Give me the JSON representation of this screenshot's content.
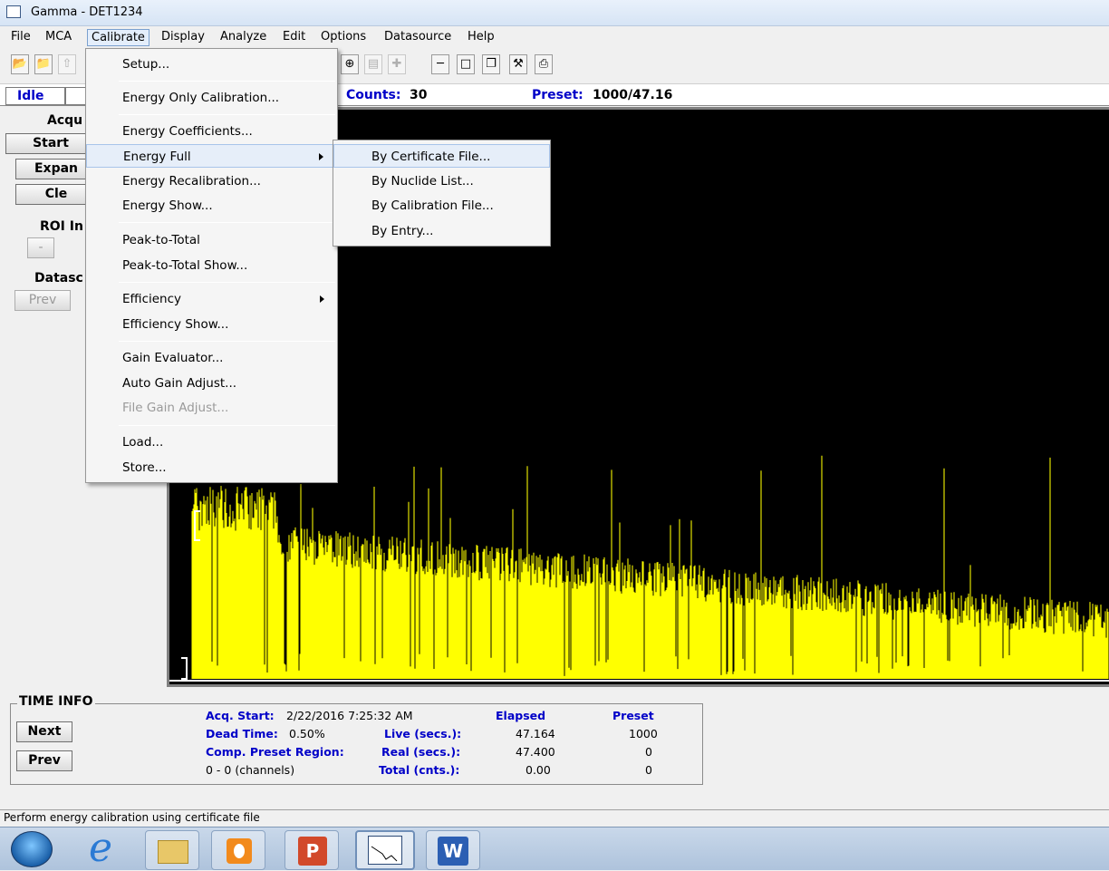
{
  "window": {
    "title": "Gamma - DET1234"
  },
  "menubar": {
    "items": [
      "File",
      "MCA",
      "Calibrate",
      "Display",
      "Analyze",
      "Edit",
      "Options",
      "Datasource",
      "Help"
    ]
  },
  "toolbar": {
    "icons": [
      "open-folder-icon",
      "open-file-icon",
      "upload-icon",
      "zoom-in-icon",
      "zoom-box-icon",
      "crosshair-icon",
      "minimize-icon",
      "restore-icon",
      "cascade-icon",
      "calibration-tool-icon",
      "print-icon"
    ]
  },
  "inforow": {
    "status": "Idle",
    "counts_label": "Counts:",
    "counts_value": "30",
    "preset_label": "Preset:",
    "preset_value": "1000/47.16"
  },
  "leftpanel": {
    "acq_label": "Acqu",
    "start_label": "Start",
    "expand_label": "Expan",
    "clear_label": "Cle",
    "roi_label": "ROI In",
    "roi_btn": "-",
    "datasource_label": "Datasc",
    "prev_label": "Prev"
  },
  "calibrate_menu": {
    "items": [
      {
        "label": "Setup..."
      },
      {
        "label": "Energy Only Calibration..."
      },
      {
        "label": "Energy Coefficients..."
      },
      {
        "label": "Energy Full"
      },
      {
        "label": "Energy Recalibration..."
      },
      {
        "label": "Energy Show..."
      },
      {
        "label": "Peak-to-Total"
      },
      {
        "label": "Peak-to-Total Show..."
      },
      {
        "label": "Efficiency"
      },
      {
        "label": "Efficiency Show..."
      },
      {
        "label": "Gain Evaluator..."
      },
      {
        "label": "Auto Gain Adjust..."
      },
      {
        "label": "File Gain Adjust..."
      },
      {
        "label": "Load..."
      },
      {
        "label": "Store..."
      }
    ]
  },
  "energy_full_submenu": {
    "items": [
      "By Certificate File...",
      "By Nuclide List...",
      "By Calibration File...",
      "By Entry..."
    ]
  },
  "time_info": {
    "title": "TIME INFO",
    "next_label": "Next",
    "prev_label": "Prev",
    "acq_start_label": "Acq. Start:",
    "acq_start_value": "2/22/2016  7:25:32 AM",
    "dead_time_label": "Dead Time:",
    "dead_time_value": "0.50%",
    "comp_preset_label": "Comp. Preset Region:",
    "channels_value": "0 - 0 (channels)",
    "elapsed_header": "Elapsed",
    "preset_header": "Preset",
    "live_label": "Live (secs.):",
    "real_label": "Real (secs.):",
    "total_label": "Total (cnts.):",
    "live_elapsed": "47.164",
    "live_preset": "1000",
    "real_elapsed": "47.400",
    "real_preset": "0",
    "total_elapsed": "0.00",
    "total_preset": "0"
  },
  "statusbar": {
    "text": "Perform energy calibration using certificate file"
  },
  "taskbar": {
    "apps": [
      "start-orb-icon",
      "internet-explorer-icon",
      "file-explorer-icon",
      "media-player-icon",
      "powerpoint-icon",
      "gamma-app-icon",
      "word-icon"
    ]
  },
  "colors": {
    "spectrum_fill": "#ffff00",
    "spectrum_bg": "#000000",
    "label_blue": "#0000c8"
  }
}
